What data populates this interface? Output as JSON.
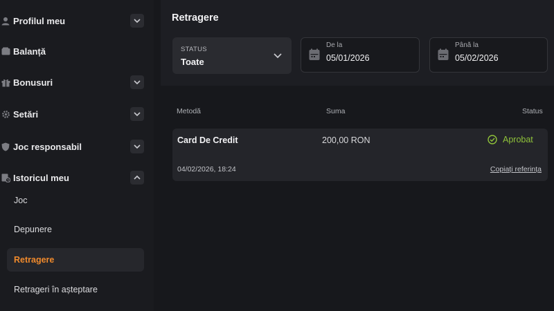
{
  "sidebar": {
    "items": [
      {
        "label": "Profilul meu",
        "icon": "user-icon"
      },
      {
        "label": "Balanță",
        "icon": "wallet-icon"
      },
      {
        "label": "Bonusuri",
        "icon": "gift-icon"
      },
      {
        "label": "Setări",
        "icon": "gear-icon"
      },
      {
        "label": "Joc responsabil",
        "icon": "shield-icon"
      },
      {
        "label": "Istoricul meu",
        "icon": "history-icon"
      }
    ],
    "sub_items": [
      {
        "label": "Joc"
      },
      {
        "label": "Depunere"
      },
      {
        "label": "Retragere"
      },
      {
        "label": "Retrageri în așteptare"
      }
    ],
    "active_sub_item": "Retragere"
  },
  "main": {
    "title": "Retragere",
    "filters": {
      "status_caption": "STATUS",
      "status_value": "Toate",
      "from_caption": "De la",
      "from_value": "05/01/2026",
      "to_caption": "Până la",
      "to_value": "05/02/2026"
    },
    "table": {
      "headers": {
        "method": "Metodă",
        "amount": "Suma",
        "status": "Status"
      },
      "rows": [
        {
          "method": "Card De Credit",
          "amount": "200,00 RON",
          "status": "Aprobat",
          "date": "04/02/2026, 18:24",
          "ref_link": "Copiați referința"
        }
      ]
    }
  },
  "colors": {
    "accent": "#f08a2c",
    "success": "#8fc23a",
    "background": "#17181c",
    "card": "#24252a"
  }
}
